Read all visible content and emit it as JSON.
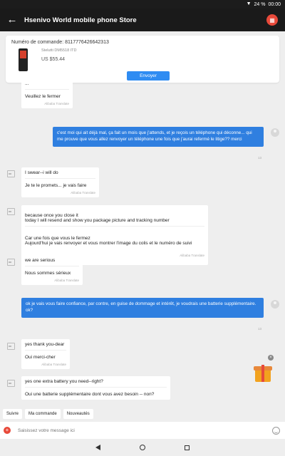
{
  "status": {
    "signal_icon": "signal-icon",
    "battery": "24 %",
    "time": "00:00"
  },
  "header": {
    "title": "Hsenivo World mobile phone Store",
    "back_icon": "back-arrow-icon",
    "store_icon": "store-icon"
  },
  "order": {
    "number_label": "Numéro de commande: 8117776426642313",
    "product_name": "Stelutti DM5518 ITD",
    "price": "US $55.44",
    "send_button": "Envoyer"
  },
  "messages": [
    {
      "id": "m0",
      "side": "in",
      "original": "...",
      "translated": "Veuillez le fermer",
      "translated_by": "Alibaba Translate"
    },
    {
      "id": "m1",
      "side": "out",
      "text": "c'est moi qui ait déjà mal, ça fait un mois que j'attends, et je reçois un téléphone qui déconne... qui me prouve que vous allez renvoyer un téléphone une fois que j'aurai refermé le litige?? merci",
      "time": "13"
    },
    {
      "id": "m2",
      "side": "in",
      "original": "I swear--i will do",
      "translated": "Je te le promets... je vais faire",
      "translated_by": "Alibaba Translate"
    },
    {
      "id": "m3",
      "side": "in",
      "original": "because once you close it\ntoday I will resend and show you package picture and tracking number",
      "translated": "Car une fois que vous le fermez\nAujourd'hui je vais renvoyer et vous montrer l'image du colis et le numéro de suivi",
      "translated_by": "Alibaba Translate"
    },
    {
      "id": "m4",
      "side": "in",
      "original": "we are serious",
      "translated": "Nous sommes sérieux",
      "translated_by": "Alibaba Translate"
    },
    {
      "id": "m5",
      "side": "out",
      "text": "ok je vais vous faire confiance, par contre, en guise de dommage et intérêt, je voudrais une batterie supplémentaire.\nok?",
      "time": "13"
    },
    {
      "id": "m6",
      "side": "in",
      "original": "yes thank you-dear",
      "translated": "Oui merci-cher",
      "translated_by": "Alibaba Translate"
    },
    {
      "id": "m7",
      "side": "in",
      "original": "yes one extra battery you need--right?",
      "translated": "Oui une batterie supplémentaire dont vous avez besoin -- non?",
      "translated_by": ""
    }
  ],
  "gift": {
    "icon": "gift-icon",
    "close_icon": "close-icon"
  },
  "quick_replies": [
    "Suivre",
    "Ma commande",
    "Nouveautés"
  ],
  "input": {
    "placeholder": "Saisissez votre message ici",
    "add_icon": "plus-icon",
    "emoji_icon": "emoji-icon"
  },
  "nav": {
    "back": "nav-back-icon",
    "home": "nav-home-icon",
    "recent": "nav-recent-icon"
  },
  "colors": {
    "header_bg": "#1a1a1a",
    "accent": "#2f7fe0",
    "brand_red": "#e8493a"
  }
}
